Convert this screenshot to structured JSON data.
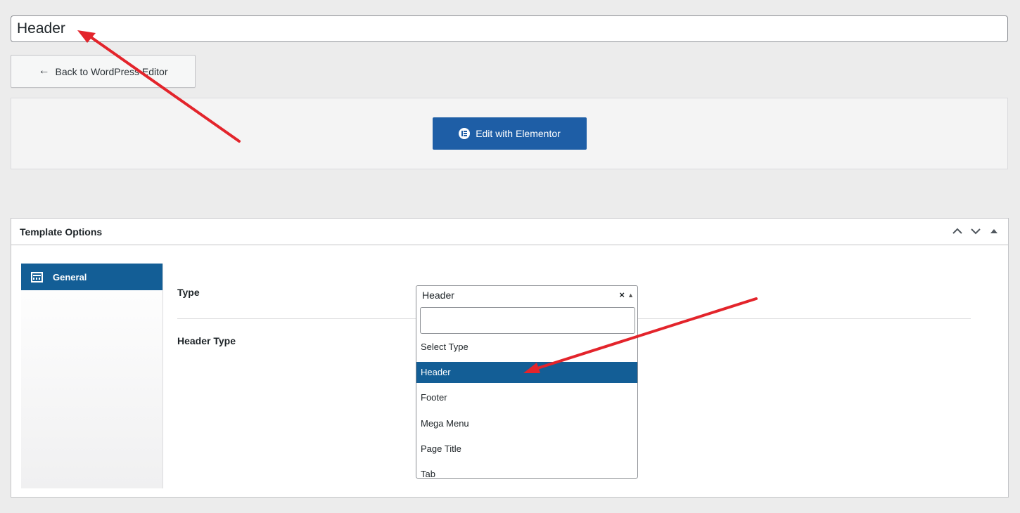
{
  "title_input": {
    "value": "Header"
  },
  "back_button": {
    "label": "Back to WordPress Editor",
    "icon": "arrow-left-icon"
  },
  "elementor_button": {
    "label": "Edit with Elementor",
    "icon": "elementor-icon"
  },
  "panel": {
    "title": "Template Options",
    "controls": [
      "chevron-up-icon",
      "chevron-down-icon",
      "triangle-up-icon"
    ],
    "sidebar": {
      "items": [
        {
          "label": "General",
          "icon": "general-icon",
          "active": true
        }
      ]
    },
    "fields": {
      "type_label": "Type",
      "header_type_label": "Header Type"
    },
    "type_select": {
      "value": "Header",
      "clear_symbol": "×",
      "search_value": "",
      "options": [
        "Select Type",
        "Header",
        "Footer",
        "Mega Menu",
        "Page Title",
        "Tab"
      ],
      "highlighted": "Header"
    }
  },
  "colors": {
    "accent": "#135e96",
    "elementor_button": "#1e5ea6",
    "annotation_arrow": "#e3242b",
    "background": "#ececec"
  },
  "annotations": [
    "red-arrow-to-title",
    "red-arrow-to-header-option"
  ]
}
